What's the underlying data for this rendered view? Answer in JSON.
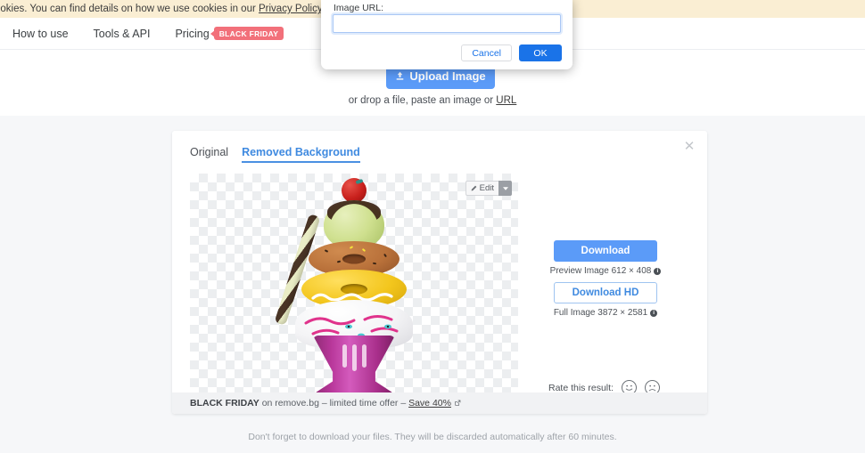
{
  "cookie_bar": {
    "text_before_link": "ookies. You can find details on how we use cookies in our ",
    "link_label": "Privacy Policy",
    "text_after_link": "."
  },
  "navbar": {
    "items": [
      {
        "label": "How to use"
      },
      {
        "label": "Tools & API"
      },
      {
        "label": "Pricing"
      }
    ],
    "badge_label": "BLACK FRIDAY"
  },
  "hero": {
    "upload_button_label": "Upload Image",
    "upload_icon": "upload-icon",
    "drop_text_before": "or drop a file, paste an image or ",
    "drop_link_label": "URL"
  },
  "result_card": {
    "close_icon": "close-icon",
    "tabs": [
      {
        "label": "Original",
        "active": false
      },
      {
        "label": "Removed Background",
        "active": true
      }
    ],
    "edit_button_label": "Edit",
    "edit_icon": "pencil-icon",
    "edit_caret_icon": "chevron-down-icon",
    "image_alt": "wooden-toy-ice-cream-sundae"
  },
  "download_panel": {
    "download_label": "Download",
    "preview_caption": "Preview Image 612 × 408",
    "preview_info_icon": "info-icon",
    "download_hd_label": "Download HD",
    "full_caption": "Full Image 3872 × 2581",
    "full_info_icon": "info-icon",
    "rate_label": "Rate this result:",
    "rate_positive_icon": "smiley-happy-icon",
    "rate_negative_icon": "smiley-sad-icon"
  },
  "black_friday_strip": {
    "strong_label": "BLACK FRIDAY",
    "middle_text": " on remove.bg – limited time offer – ",
    "link_label": "Save 40%",
    "external_icon": "external-link-icon"
  },
  "footer": {
    "note": "Don't forget to download your files. They will be discarded automatically after 60 minutes."
  },
  "dialog": {
    "label": "Image URL:",
    "input_value": "",
    "input_placeholder": "",
    "cancel_label": "Cancel",
    "ok_label": "OK"
  },
  "colors": {
    "accent_blue": "#5b9bf8",
    "dialog_blue": "#1a73e8",
    "tab_active": "#4a90e2",
    "badge_red": "#f2707a",
    "cookie_bg": "#faeed3",
    "page_bg": "#f6f7f9"
  }
}
